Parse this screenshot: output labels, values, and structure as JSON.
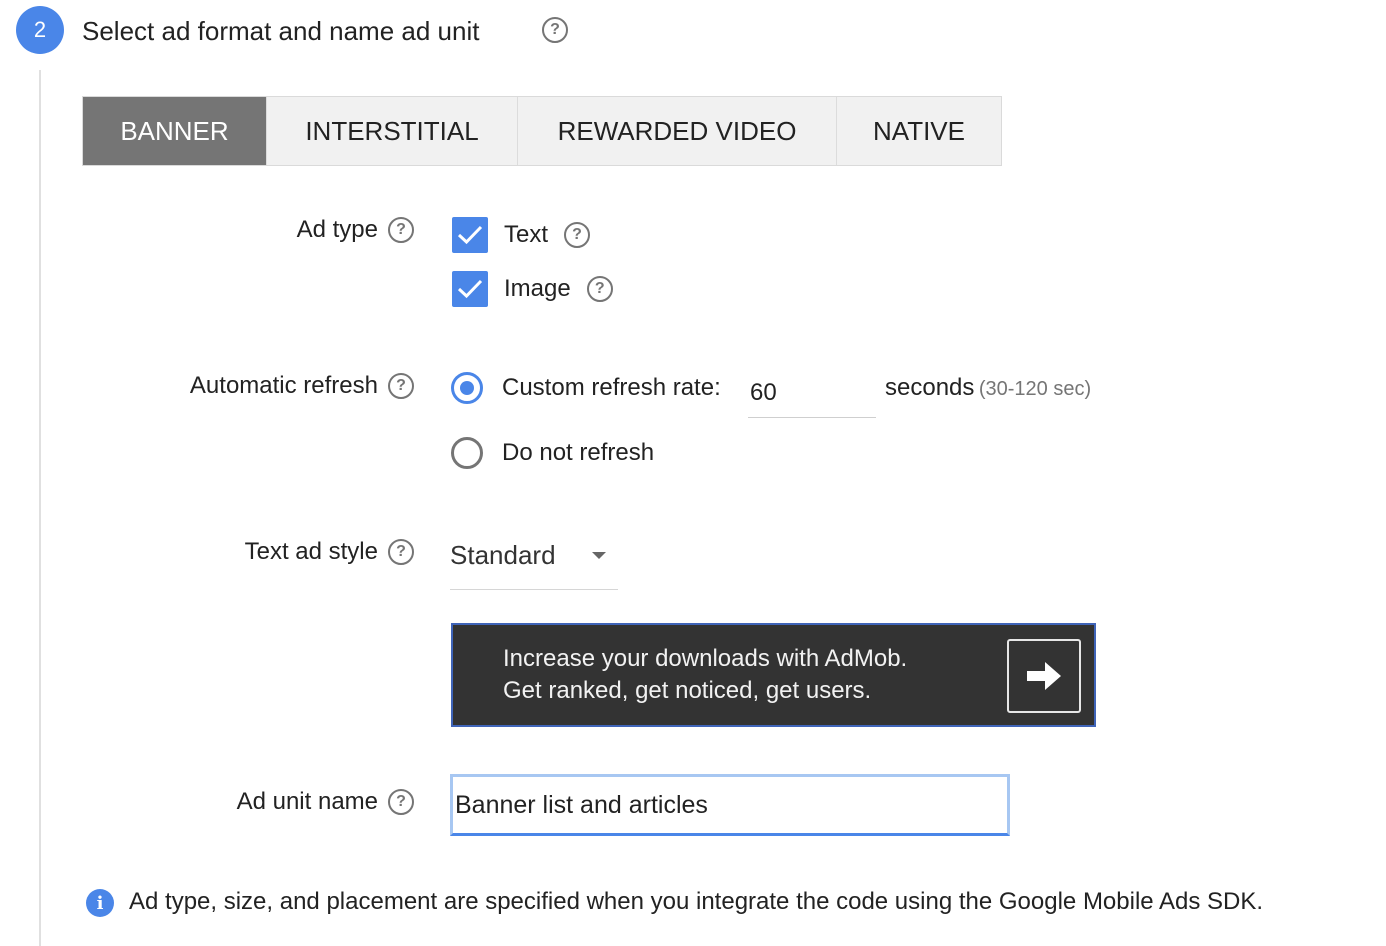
{
  "step": {
    "number": "2",
    "title": "Select ad format and name ad unit"
  },
  "tabs": [
    {
      "label": "BANNER",
      "active": true
    },
    {
      "label": "INTERSTITIAL",
      "active": false
    },
    {
      "label": "REWARDED VIDEO",
      "active": false
    },
    {
      "label": "NATIVE",
      "active": false
    }
  ],
  "ad_type": {
    "label": "Ad type",
    "options": [
      {
        "label": "Text",
        "checked": true
      },
      {
        "label": "Image",
        "checked": true
      }
    ]
  },
  "automatic_refresh": {
    "label": "Automatic refresh",
    "custom_label": "Custom refresh rate:",
    "custom_selected": true,
    "rate_value": "60",
    "seconds_label": "seconds",
    "range_hint": "(30-120 sec)",
    "no_refresh_label": "Do not refresh"
  },
  "text_ad_style": {
    "label": "Text ad style",
    "selected": "Standard"
  },
  "preview": {
    "line1": "Increase your downloads with AdMob.",
    "line2": "Get ranked, get noticed, get users."
  },
  "ad_unit_name": {
    "label": "Ad unit name",
    "value": "Banner list and articles"
  },
  "info": {
    "icon": "i",
    "text": "Ad type, size, and placement are specified when you integrate the code using the Google Mobile Ads SDK."
  },
  "icons": {
    "help": "?",
    "accent": "#4a86e8"
  }
}
